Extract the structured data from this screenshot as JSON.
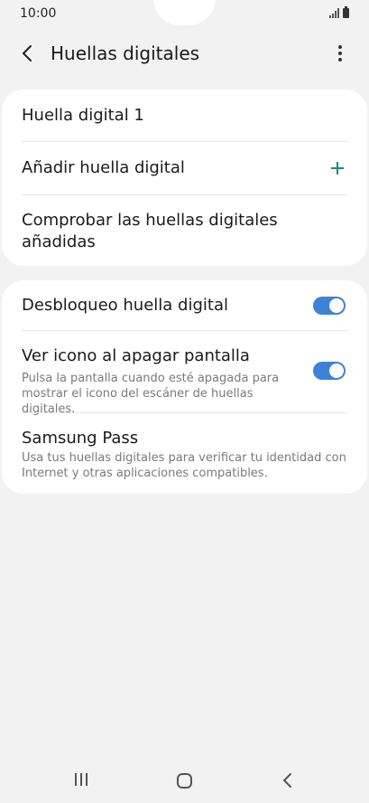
{
  "status_bar": {
    "time": "10:00"
  },
  "app_bar": {
    "title": "Huellas digitales"
  },
  "fingerprints_card": {
    "fingerprint_1": "Huella digital 1",
    "add_fingerprint": "Añadir huella digital",
    "check_fingerprints": "Comprobar las huellas digitales añadidas"
  },
  "settings_card": {
    "unlock": {
      "title": "Desbloqueo huella digital",
      "enabled": true
    },
    "show_icon": {
      "title": "Ver icono al apagar pantalla",
      "subtitle": "Pulsa la pantalla cuando esté apagada para mostrar el icono del escáner de huellas digitales.",
      "enabled": true
    },
    "samsung_pass": {
      "title": "Samsung Pass",
      "subtitle": "Usa tus huellas digitales para verificar tu identidad con Internet y otras aplicaciones compatibles."
    }
  },
  "colors": {
    "accent": "#3e82d6",
    "plus": "#1f8a7a",
    "background": "#f2f2f2"
  },
  "icons": {
    "back": "chevron-left-icon",
    "more": "more-vertical-icon",
    "add": "plus-icon",
    "nav_recents": "recents-icon",
    "nav_home": "home-icon",
    "nav_back": "nav-back-icon"
  }
}
